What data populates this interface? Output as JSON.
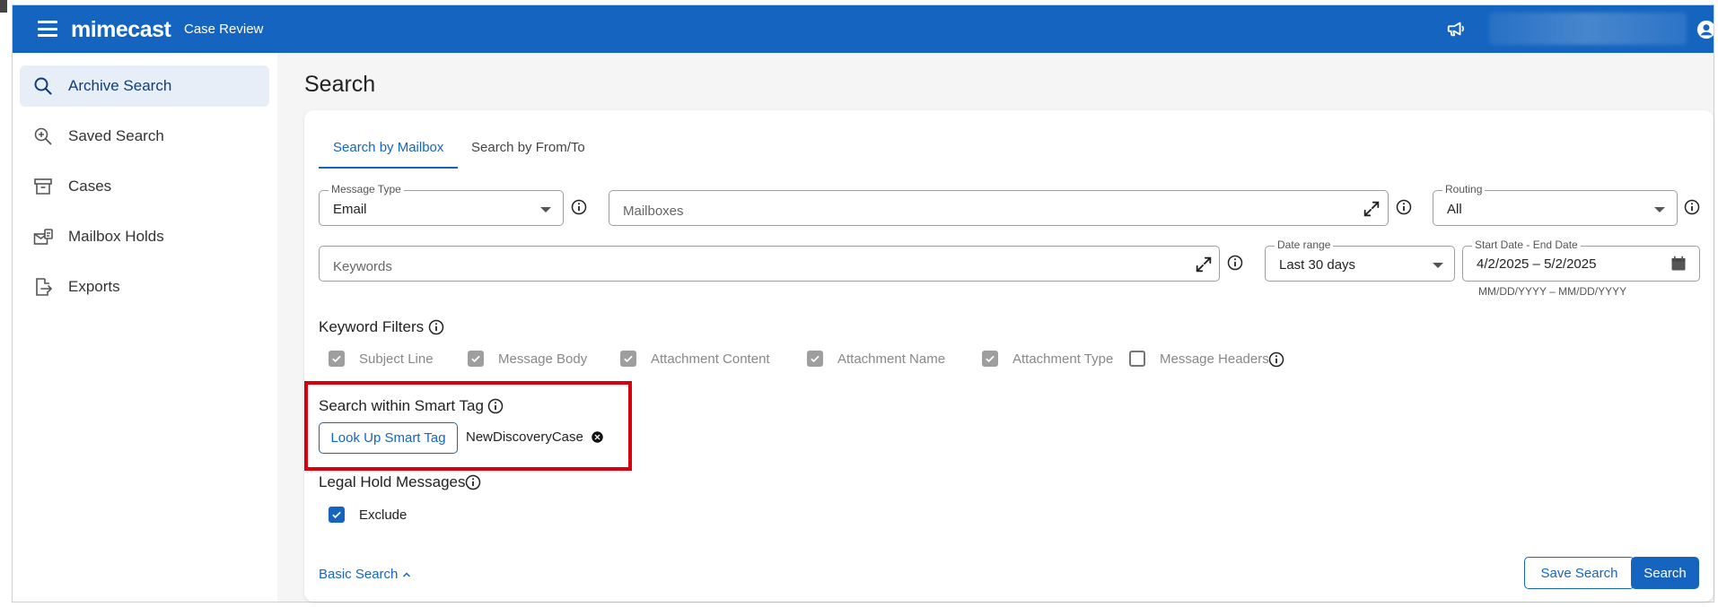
{
  "header": {
    "brand": "mimecast",
    "product": "Case Review"
  },
  "sidebar": {
    "items": [
      {
        "label": "Archive Search",
        "icon": "search-icon",
        "active": true
      },
      {
        "label": "Saved Search",
        "icon": "zoom-plus-icon",
        "active": false
      },
      {
        "label": "Cases",
        "icon": "archive-box-icon",
        "active": false
      },
      {
        "label": "Mailbox Holds",
        "icon": "mailbox-hold-icon",
        "active": false
      },
      {
        "label": "Exports",
        "icon": "export-icon",
        "active": false
      }
    ]
  },
  "main": {
    "title": "Search",
    "tabs": [
      {
        "label": "Search by Mailbox",
        "active": true
      },
      {
        "label": "Search by From/To",
        "active": false
      }
    ],
    "message_type": {
      "label": "Message Type",
      "value": "Email"
    },
    "mailboxes": {
      "placeholder": "Mailboxes"
    },
    "routing": {
      "label": "Routing",
      "value": "All"
    },
    "keywords": {
      "placeholder": "Keywords"
    },
    "date_range": {
      "label": "Date range",
      "value": "Last 30 days"
    },
    "start_end": {
      "label": "Start Date - End Date",
      "value": "4/2/2025 – 5/2/2025",
      "hint": "MM/DD/YYYY – MM/DD/YYYY"
    },
    "keyword_filters": {
      "title": "Keyword Filters",
      "options": [
        {
          "label": "Subject Line",
          "checked": true
        },
        {
          "label": "Message Body",
          "checked": true
        },
        {
          "label": "Attachment Content",
          "checked": true
        },
        {
          "label": "Attachment Name",
          "checked": true
        },
        {
          "label": "Attachment Type",
          "checked": true
        },
        {
          "label": "Message Headers",
          "checked": false
        }
      ]
    },
    "smart_tag": {
      "title": "Search within Smart Tag",
      "button": "Look Up Smart Tag",
      "selected": "NewDiscoveryCase"
    },
    "legal_hold": {
      "title": "Legal Hold Messages",
      "option": "Exclude",
      "checked": true
    },
    "basic_search_link": "Basic Search",
    "save_search_button": "Save Search",
    "search_button": "Search"
  },
  "colors": {
    "brand_blue": "#1565c0",
    "highlight_red": "#d9000d"
  }
}
